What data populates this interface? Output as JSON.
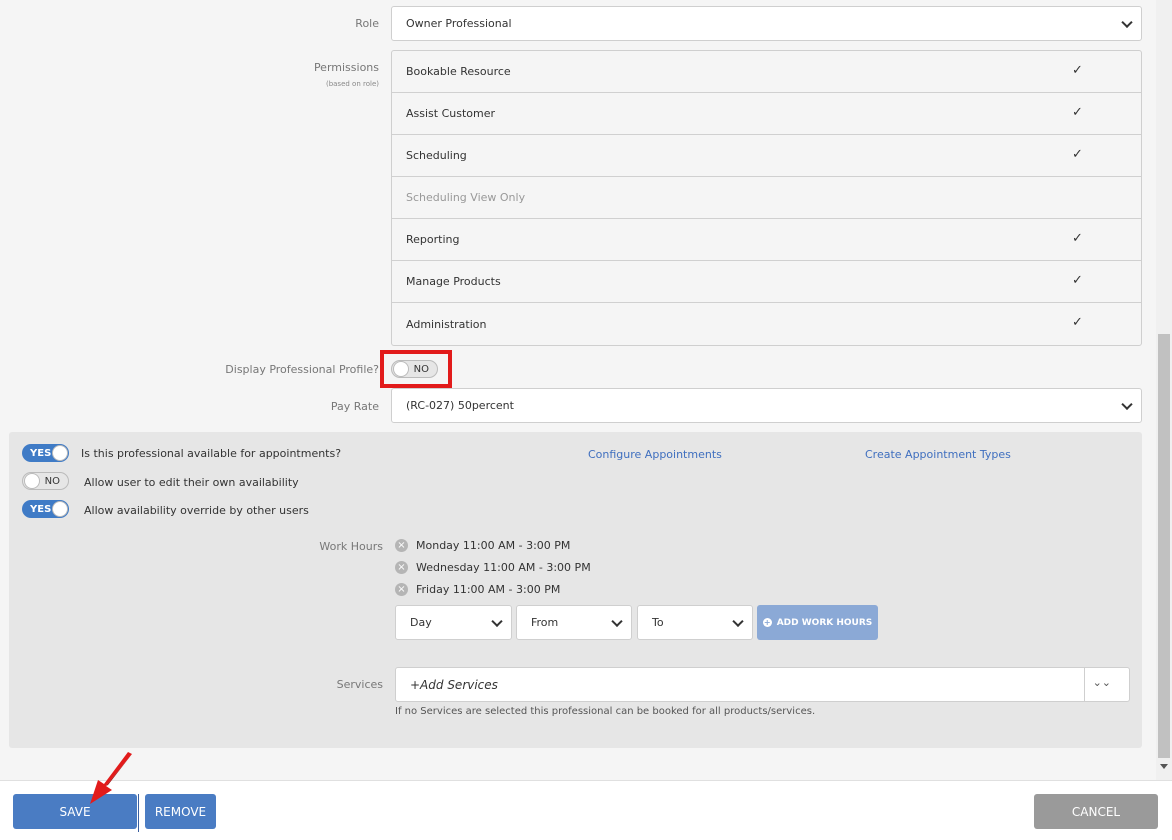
{
  "role": {
    "label": "Role",
    "value": "Owner Professional"
  },
  "permissions": {
    "label": "Permissions",
    "sublabel": "(based on role)",
    "items": [
      {
        "name": "Bookable Resource",
        "checked": true,
        "mark": "✓"
      },
      {
        "name": "Assist Customer",
        "checked": true,
        "mark": "✓"
      },
      {
        "name": "Scheduling",
        "checked": true,
        "mark": "✓"
      },
      {
        "name": "Scheduling View Only",
        "checked": false,
        "mark": ""
      },
      {
        "name": "Reporting",
        "checked": true,
        "mark": "✓"
      },
      {
        "name": "Manage Products",
        "checked": true,
        "mark": "✓"
      },
      {
        "name": "Administration",
        "checked": true,
        "mark": "✓"
      }
    ]
  },
  "display_profile": {
    "label": "Display Professional Profile?",
    "toggle": "NO"
  },
  "pay_rate": {
    "label": "Pay Rate",
    "value": "(RC-027) 50percent"
  },
  "availability": {
    "available": {
      "toggle": "YES",
      "text": "Is this professional available for appointments?"
    },
    "edit_own": {
      "toggle": "NO",
      "text": "Allow user to edit their own availability"
    },
    "override": {
      "toggle": "YES",
      "text": "Allow availability override by other users"
    },
    "configure_link": "Configure Appointments",
    "create_types_link": "Create Appointment Types"
  },
  "work_hours": {
    "label": "Work Hours",
    "entries": [
      "Monday 11:00 AM - 3:00 PM",
      "Wednesday 11:00 AM - 3:00 PM",
      "Friday 11:00 AM - 3:00 PM"
    ],
    "day_select": "Day",
    "from_select": "From",
    "to_select": "To",
    "add_button": "ADD WORK HOURS"
  },
  "services": {
    "label": "Services",
    "placeholder": "+Add Services",
    "hint": "If no Services are selected this professional can be booked for all products/services."
  },
  "footer": {
    "save": "SAVE",
    "remove": "REMOVE",
    "cancel": "CANCEL"
  },
  "colors": {
    "primary": "#4a7cc3",
    "link": "#3f6fbf",
    "highlight": "#e21b1b",
    "cancel": "#9a9a9a"
  }
}
